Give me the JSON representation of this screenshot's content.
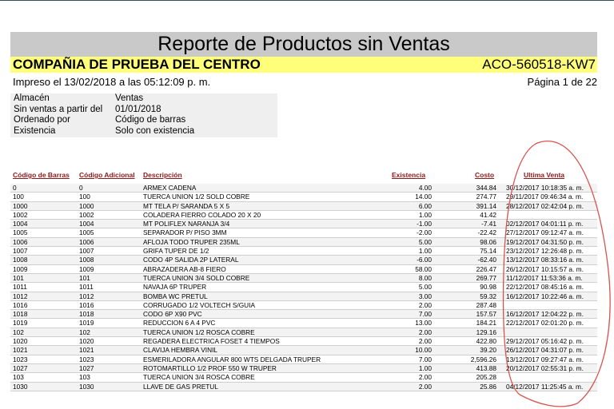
{
  "report": {
    "title": "Reporte de Productos sin Ventas",
    "company": "COMPAÑIA DE PRUEBA DEL CENTRO",
    "code": "ACO-560518-KW7",
    "printed": "Impreso el 13/02/2018 a las 05:12:09 p. m.",
    "page": "Página 1 de 22"
  },
  "params": {
    "labels": [
      "Almacén",
      "Sin ventas a partir del",
      "Ordenado por",
      "Existencia"
    ],
    "values": [
      "Ventas",
      "01/01/2018",
      "Código de barras",
      "Solo con existencia"
    ]
  },
  "table": {
    "headers": [
      "Código de Barras",
      "Código Adicional",
      "Descripción",
      "Existencia",
      "Costo",
      "Ultima Venta"
    ],
    "rows": [
      [
        "0",
        "0",
        "ARMEX CADENA",
        "4.00",
        "344.84",
        "30/12/2017 10:18:35 a. m."
      ],
      [
        "100",
        "100",
        "TUERCA UNION 1/2 SOLD COBRE",
        "14.00",
        "274.77",
        "29/11/2017 09:46:34 a. m."
      ],
      [
        "1000",
        "1000",
        "MT TELA P/ SARANDA 5 X 5",
        "6.00",
        "391.14",
        "28/12/2017 02:42:04 p. m."
      ],
      [
        "1002",
        "1002",
        "COLADERA FIERRO COLADO 20 X 20",
        "1.00",
        "41.42",
        ""
      ],
      [
        "1004",
        "1004",
        "MT POLIFLEX NARANJA 3/4",
        "-1.00",
        "-7.41",
        "02/12/2017 04:01:11 p. m."
      ],
      [
        "1005",
        "1005",
        "SEPARADOR P/ PISO 3MM",
        "-2.00",
        "-22.42",
        "27/12/2017 09:12:47 a. m."
      ],
      [
        "1006",
        "1006",
        "AFLOJA TODO TRUPER 235ML",
        "5.00",
        "98.06",
        "19/12/2017 04:31:50 p. m."
      ],
      [
        "1007",
        "1007",
        "GRIFA TUPER DE 1/2",
        "1.00",
        "75.14",
        "23/12/2017 12:26:48 p. m."
      ],
      [
        "1008",
        "1008",
        "CODO 4P SALIDA 2P LATERAL",
        "-6.00",
        "-62.40",
        "13/12/2017 08:33:16 a. m."
      ],
      [
        "1009",
        "1009",
        "ABRAZADERA AB-8 FIERO",
        "58.00",
        "226.47",
        "26/12/2017 10:15:57 a. m."
      ],
      [
        "101",
        "101",
        "TUERCA UNION 3/4 SOLD COBRE",
        "8.00",
        "269.77",
        "11/12/2017 11:53:36 a. m."
      ],
      [
        "1011",
        "1011",
        "NAVAJA 6P TRUPER",
        "5.00",
        "90.98",
        "22/12/2017 08:45:16 a. m."
      ],
      [
        "1012",
        "1012",
        "BOMBA WC PRETUL",
        "3.00",
        "59.32",
        "16/12/2017 10:22:46 a. m."
      ],
      [
        "1016",
        "1016",
        "CORRUGADO 1/2 VOLTECH S/GUIA",
        "2.00",
        "287.48",
        ""
      ],
      [
        "1018",
        "1018",
        "CODO 6P X90 PVC",
        "7.00",
        "157.57",
        "16/12/2017 12:04:22 p. m."
      ],
      [
        "1019",
        "1019",
        "REDUCCION 6 A 4 PVC",
        "13.00",
        "184.21",
        "22/12/2017 02:01:20 p. m."
      ],
      [
        "102",
        "102",
        "TUERCA UNION 1/2 ROSCA COBRE",
        "2.00",
        "129.16",
        ""
      ],
      [
        "1020",
        "1020",
        "REGADERA ELECTRICA FOSET 4 TIEMPOS",
        "2.00",
        "422.80",
        "29/12/2017 05:16:42 p. m."
      ],
      [
        "1021",
        "1021",
        "CLAVIJA HEMBRA VINIL",
        "10.00",
        "39.20",
        "26/12/2017 04:31:07 p. m."
      ],
      [
        "1023",
        "1023",
        "ESMERILADORA ANGULAR 800 WTS DELGADA TRUPER",
        "7.00",
        "2,596.26",
        "13/12/2017 09:27:47 a. m."
      ],
      [
        "1027",
        "1027",
        "ROTOMARTILLO 1/2 PROF 550 W TRUPER",
        "1.00",
        "413.88",
        "20/12/2017 02:55:31 p. m."
      ],
      [
        "103",
        "103",
        "TUERCA UNION 3/4 ROSCA COBRE",
        "2.00",
        "205.28",
        ""
      ],
      [
        "1030",
        "1030",
        "LLAVE DE GAS PRETUL",
        "2.00",
        "25.86",
        "04/12/2017 11:25:45 a. m."
      ]
    ]
  },
  "colors": {
    "title_bg": "#c9c9c9",
    "company_bg": "#ffff7a",
    "header_text": "#8b1a1a",
    "annotation": "#d9534f"
  }
}
